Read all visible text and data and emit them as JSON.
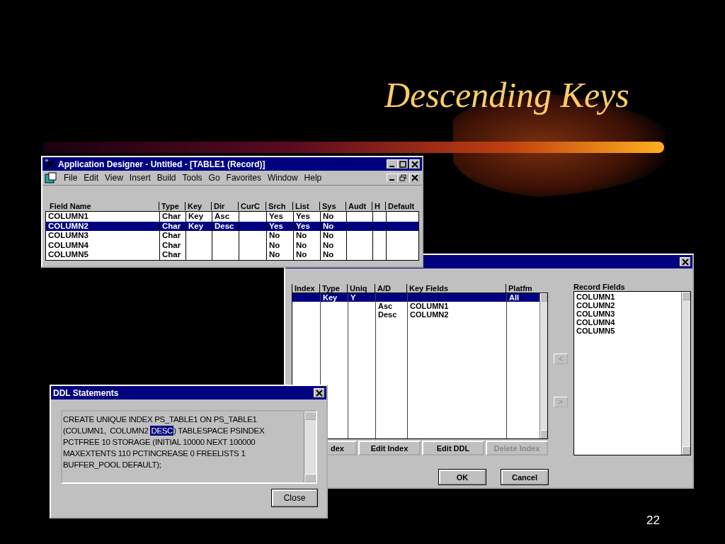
{
  "slide": {
    "title": "Descending Keys",
    "page_number": "22"
  },
  "app_window": {
    "title": "Application Designer - Untitled - [TABLE1 (Record)]",
    "menu": [
      "File",
      "Edit",
      "View",
      "Insert",
      "Build",
      "Tools",
      "Go",
      "Favorites",
      "Window",
      "Help"
    ],
    "columns": [
      "Field Name",
      "Type",
      "Key",
      "Dir",
      "CurC",
      "Srch",
      "List",
      "Sys",
      "Audt",
      "H",
      "Default"
    ],
    "rows": [
      {
        "field_name": "COLUMN1",
        "type": "Char",
        "key": "Key",
        "dir": "Asc",
        "srch": "Yes",
        "list": "Yes",
        "sys": "No",
        "selected": false
      },
      {
        "field_name": "COLUMN2",
        "type": "Char",
        "key": "Key",
        "dir": "Desc",
        "srch": "Yes",
        "list": "Yes",
        "sys": "No",
        "selected": true
      },
      {
        "field_name": "COLUMN3",
        "type": "Char",
        "srch": "No",
        "list": "No",
        "sys": "No",
        "selected": false
      },
      {
        "field_name": "COLUMN4",
        "type": "Char",
        "srch": "No",
        "list": "No",
        "sys": "No",
        "selected": false
      },
      {
        "field_name": "COLUMN5",
        "type": "Char",
        "srch": "No",
        "list": "No",
        "sys": "No",
        "selected": false
      }
    ]
  },
  "index_dialog": {
    "columns": [
      "Index",
      "Type",
      "Uniq",
      "A/D",
      "Key Fields",
      "Platfm"
    ],
    "rows": [
      {
        "type": "Key",
        "uniq": "Y",
        "platfm": "All",
        "selected": true
      },
      {
        "ad": "Asc",
        "key_fields": "COLUMN1",
        "selected": false
      },
      {
        "ad": "Desc",
        "key_fields": "COLUMN2",
        "selected": false
      }
    ],
    "record_fields_label": "Record Fields",
    "record_fields": [
      "COLUMN1",
      "COLUMN2",
      "COLUMN3",
      "COLUMN4",
      "COLUMN5"
    ],
    "move_buttons": [
      "<",
      ">"
    ],
    "buttons": [
      {
        "label": "dex",
        "disabled": false
      },
      {
        "label": "Edit Index",
        "disabled": false
      },
      {
        "label": "Edit DDL",
        "disabled": false
      },
      {
        "label": "Delete Index",
        "disabled": true
      }
    ],
    "dialog_buttons": [
      "OK",
      "Cancel"
    ]
  },
  "ddl_dialog": {
    "title": "DDL Statements",
    "lines": [
      [
        {
          "text": "CREATE UNIQUE INDEX PS_TABLE1 ON PS_TABLE1",
          "selected": false
        }
      ],
      [
        {
          "text": "(COLUMN1,  COLUMN2 ",
          "selected": false
        },
        {
          "text": "DESC",
          "selected": true
        },
        {
          "text": ") TABLESPACE PSINDEX",
          "selected": false
        }
      ],
      [
        {
          "text": "PCTFREE 10 STORAGE (INITIAL 10000 NEXT 100000",
          "selected": false
        }
      ],
      [
        {
          "text": "MAXEXTENTS 110 PCTINCREASE 0 FREELISTS 1",
          "selected": false
        }
      ],
      [
        {
          "text": "BUFFER_POOL DEFAULT);",
          "selected": false
        }
      ]
    ],
    "close_button": "Close"
  }
}
